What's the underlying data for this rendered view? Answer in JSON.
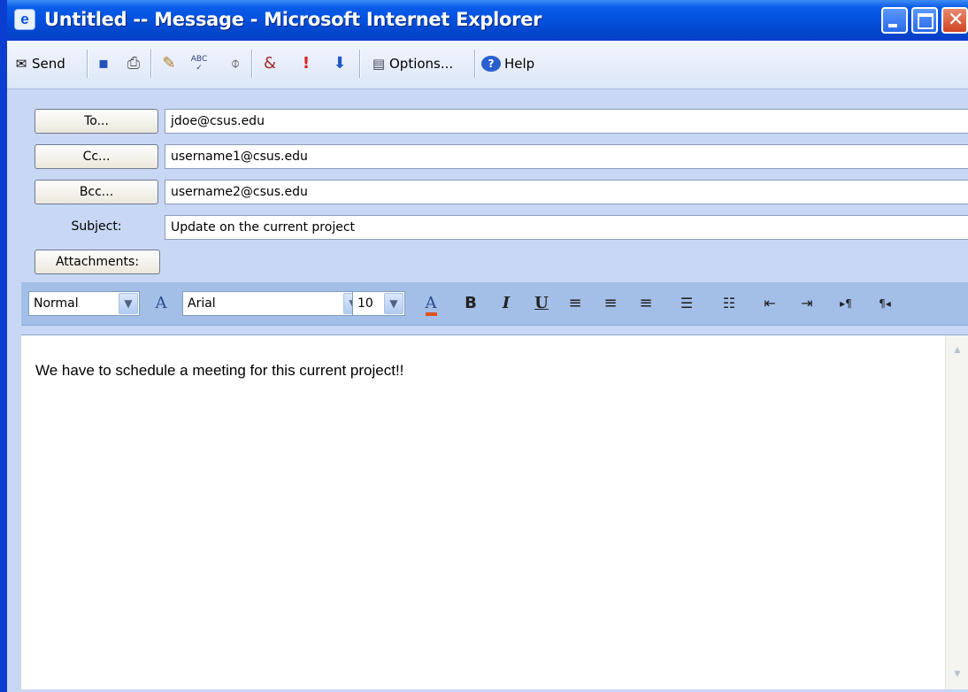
{
  "window": {
    "title": "Untitled -- Message - Microsoft Internet Explorer",
    "title_icon": "ie-message-icon",
    "controls": [
      "minimize-icon",
      "maximize-icon",
      "close-icon"
    ]
  },
  "toolbar": {
    "send_label": "Send",
    "options_label": "Options...",
    "help_label": "Help",
    "spell_label": "ABC",
    "icons": [
      "send-icon",
      "save-icon",
      "print-icon",
      "address-book-icon",
      "spell-check-icon",
      "attach-icon",
      "sign-icon",
      "high-priority-icon",
      "low-priority-icon",
      "options-icon",
      "help-icon"
    ]
  },
  "header": {
    "to_button": "To...",
    "cc_button": "Cc...",
    "bcc_button": "Bcc...",
    "subject_label": "Subject:",
    "attachments_button": "Attachments:",
    "to_value": "jdoe@csus.edu",
    "cc_value": "username1@csus.edu",
    "bcc_value": "username2@csus.edu",
    "subject_value": "Update on the current project"
  },
  "format": {
    "style_value": "Normal",
    "font_value": "Arial",
    "size_value": "10",
    "bold": "B",
    "italic": "I",
    "underline": "U",
    "font_color_glyph": "A",
    "font_icon_glyph": "A",
    "accent_color": "#e05020"
  },
  "body": {
    "text": "We have to schedule a meeting for this current project!!"
  }
}
